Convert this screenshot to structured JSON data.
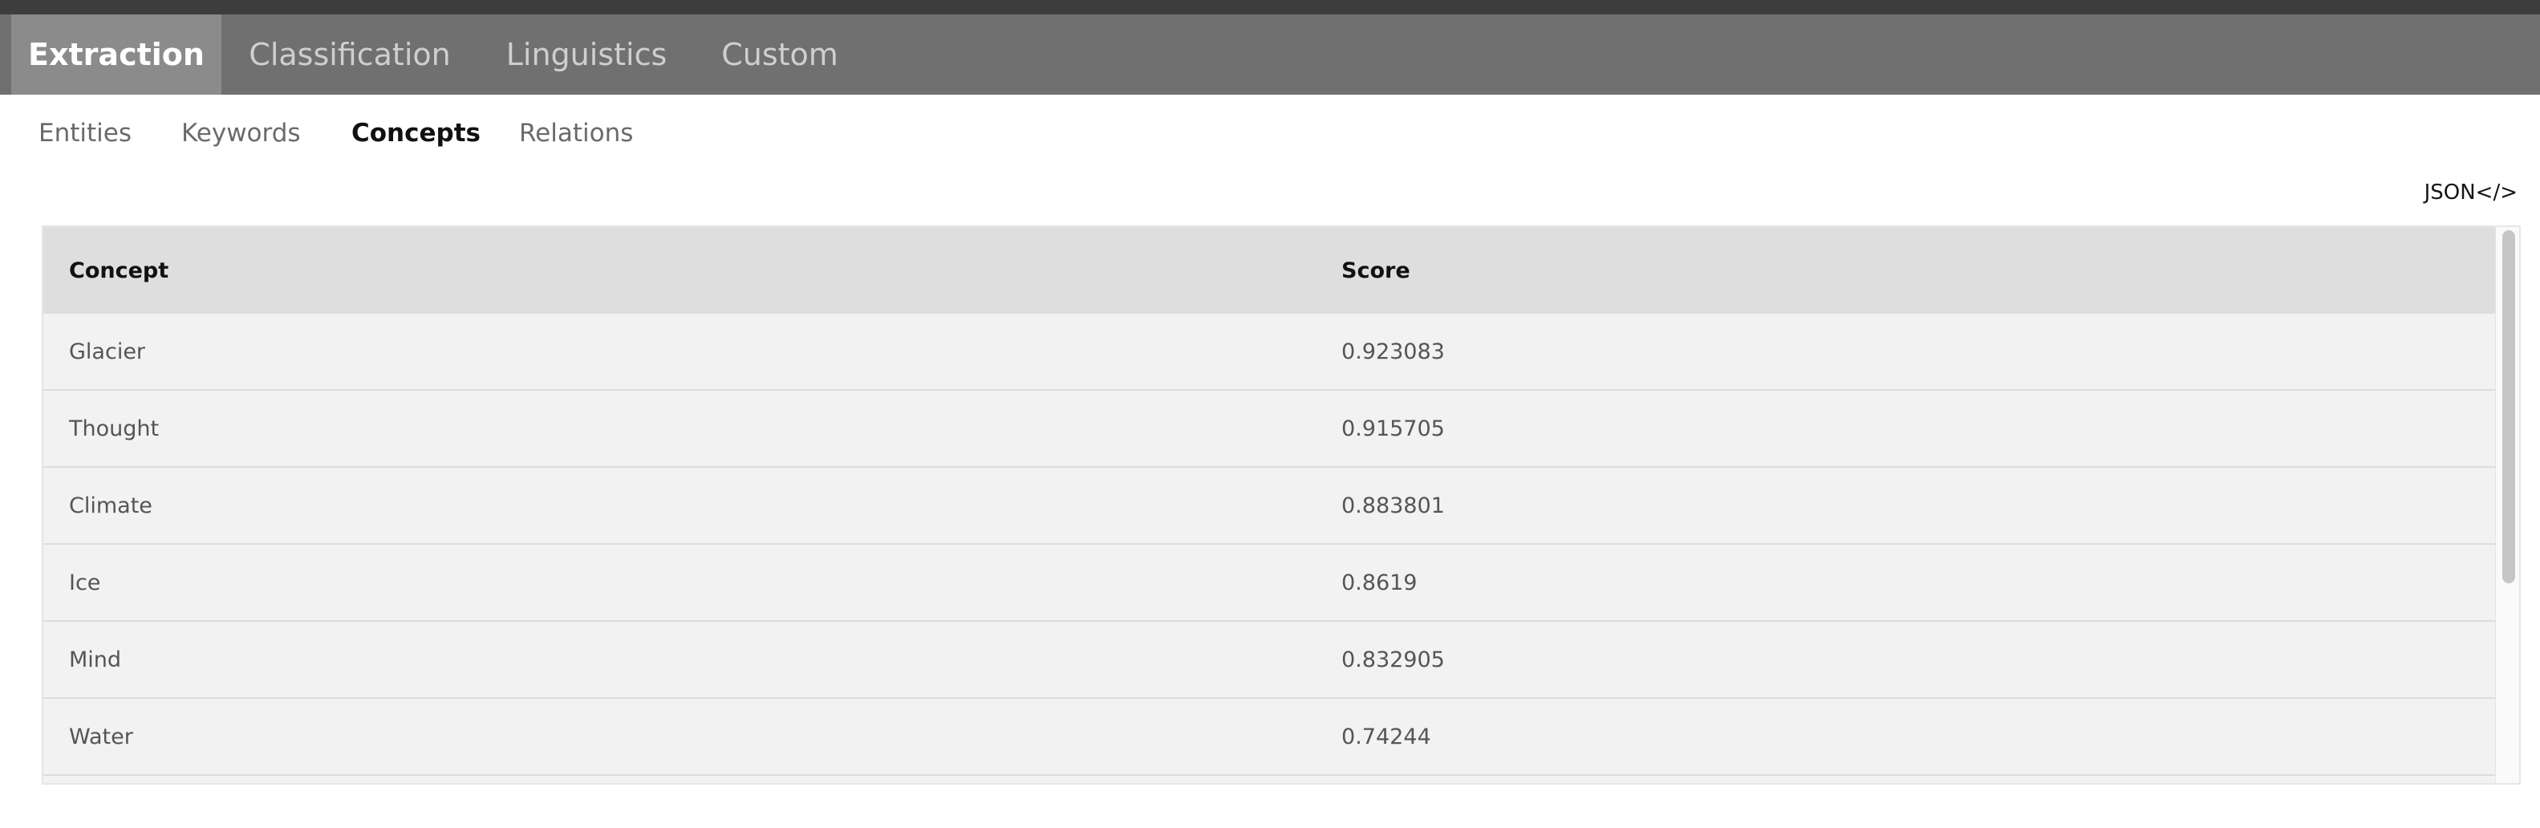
{
  "main_tabs": [
    {
      "label": "Extraction",
      "active": true
    },
    {
      "label": "Classification",
      "active": false
    },
    {
      "label": "Linguistics",
      "active": false
    },
    {
      "label": "Custom",
      "active": false
    }
  ],
  "sub_tabs": [
    {
      "label": "Entities",
      "active": false
    },
    {
      "label": "Keywords",
      "active": false
    },
    {
      "label": "Concepts",
      "active": true
    },
    {
      "label": "Relations",
      "active": false
    }
  ],
  "json_link": {
    "label": "JSON</>"
  },
  "table": {
    "columns": [
      "Concept",
      "Score"
    ],
    "rows": [
      [
        "Glacier",
        "0.923083"
      ],
      [
        "Thought",
        "0.915705"
      ],
      [
        "Climate",
        "0.883801"
      ],
      [
        "Ice",
        "0.8619"
      ],
      [
        "Mind",
        "0.832905"
      ],
      [
        "Water",
        "0.74244"
      ]
    ]
  },
  "colors": {
    "top_strip": "#3d3d3d",
    "tab_bar": "#707070",
    "active_tab": "#8b8b8b",
    "table_header": "#dedede",
    "table_row": "#f2f2f2"
  }
}
